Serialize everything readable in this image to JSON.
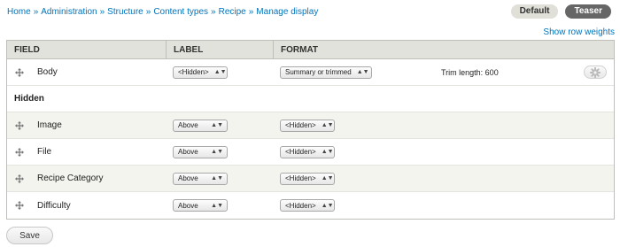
{
  "breadcrumb": [
    {
      "label": "Home"
    },
    {
      "label": "Administration"
    },
    {
      "label": "Structure"
    },
    {
      "label": "Content types"
    },
    {
      "label": "Recipe"
    },
    {
      "label": "Manage display"
    }
  ],
  "breadcrumb_separator": "»",
  "view_modes": [
    {
      "label": "Default",
      "active": false
    },
    {
      "label": "Teaser",
      "active": true
    }
  ],
  "show_row_weights": "Show row weights",
  "table": {
    "headers": {
      "field": "Field",
      "label": "Label",
      "format": "Format"
    },
    "visible_rows": [
      {
        "name": "Body",
        "label": "<Hidden>",
        "format": "Summary or trimmed",
        "summary": "Trim length: 600"
      }
    ],
    "hidden_region_title": "Hidden",
    "hidden_rows": [
      {
        "name": "Image",
        "label": "Above",
        "format": "<Hidden>"
      },
      {
        "name": "File",
        "label": "Above",
        "format": "<Hidden>"
      },
      {
        "name": "Recipe Category",
        "label": "Above",
        "format": "<Hidden>"
      },
      {
        "name": "Difficulty",
        "label": "Above",
        "format": "<Hidden>"
      }
    ]
  },
  "select_arrows": "▲▼",
  "save_label": "Save",
  "icons": {
    "drag": "move-cross-icon",
    "settings": "gear-icon"
  },
  "colors": {
    "link": "#0074bd",
    "header_bg": "#e1e2dc",
    "active_tab": "#666666"
  }
}
